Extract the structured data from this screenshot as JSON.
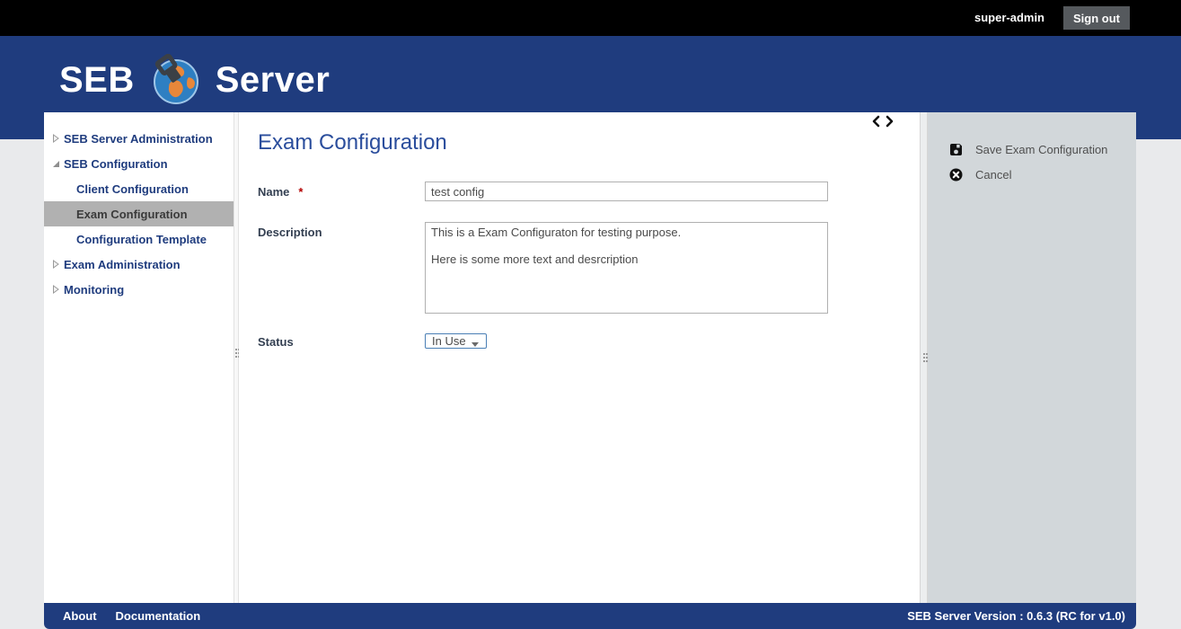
{
  "topbar": {
    "username": "super-admin",
    "signout_label": "Sign out"
  },
  "brand": {
    "word_left": "SEB",
    "word_right": "Server"
  },
  "sidebar": {
    "items": [
      {
        "label": "SEB Server Administration",
        "state": "collapsed",
        "level": 0,
        "selected": false
      },
      {
        "label": "SEB Configuration",
        "state": "expanded",
        "level": 0,
        "selected": false
      },
      {
        "label": "Client Configuration",
        "state": "leaf",
        "level": 1,
        "selected": false
      },
      {
        "label": "Exam Configuration",
        "state": "leaf",
        "level": 1,
        "selected": true
      },
      {
        "label": "Configuration Template",
        "state": "leaf",
        "level": 1,
        "selected": false
      },
      {
        "label": "Exam Administration",
        "state": "collapsed",
        "level": 0,
        "selected": false
      },
      {
        "label": "Monitoring",
        "state": "collapsed",
        "level": 0,
        "selected": false
      }
    ]
  },
  "main": {
    "title": "Exam Configuration",
    "required_marker": "*",
    "fields": [
      {
        "label": "Name",
        "required": true,
        "type": "text",
        "value": "test config"
      },
      {
        "label": "Description",
        "required": false,
        "type": "textarea",
        "value": "This is a Exam Configuraton for testing purpose.\n\nHere is some more text and desrcription"
      },
      {
        "label": "Status",
        "required": false,
        "type": "select",
        "value": "In Use"
      }
    ]
  },
  "actions": {
    "items": [
      {
        "label": "Save Exam Configuration",
        "icon": "save-icon"
      },
      {
        "label": "Cancel",
        "icon": "cancel-icon"
      }
    ]
  },
  "footer": {
    "links": [
      "About",
      "Documentation"
    ],
    "version": "SEB Server Version : 0.6.3 (RC for v1.0)"
  },
  "colors": {
    "topbar_black": "#000000",
    "header_blue": "#1f3c7e",
    "title_blue": "#2a4d9c",
    "nav_blue": "#1f3c7e",
    "selected_gray": "#b1b1b1",
    "panel_gray": "#d2d7da",
    "page_bg": "#e9eaec",
    "required_red": "#b30000",
    "select_border_blue": "#4a7fb5",
    "signout_gray": "#55595d"
  }
}
